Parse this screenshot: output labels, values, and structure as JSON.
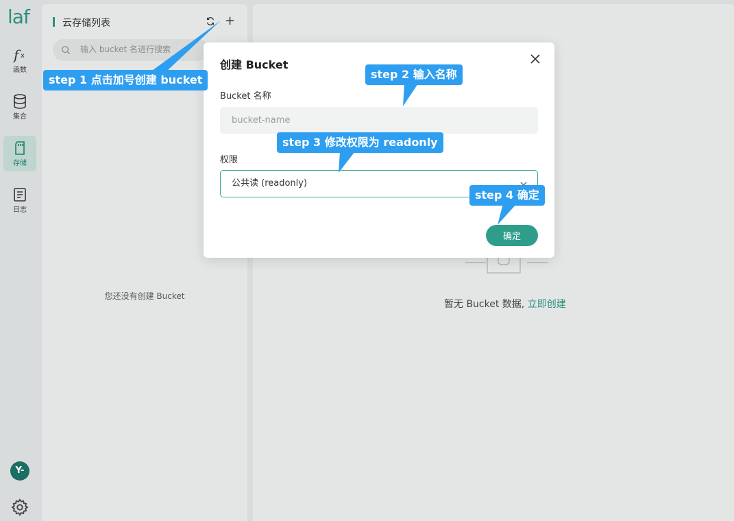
{
  "nav": {
    "logo": "laf",
    "items": [
      {
        "label": "函数",
        "icon": "function-icon"
      },
      {
        "label": "集合",
        "icon": "database-icon"
      },
      {
        "label": "存储",
        "icon": "storage-icon"
      },
      {
        "label": "日志",
        "icon": "log-icon"
      }
    ],
    "avatar": "Y-"
  },
  "panel": {
    "title": "云存储列表",
    "refresh_icon": "refresh-icon",
    "add_icon": "+",
    "search_placeholder": "输入 bucket 名进行搜索",
    "empty": "您还没有创建 Bucket"
  },
  "main": {
    "empty_text": "暂无 Bucket 数据,",
    "create_link": "立即创建"
  },
  "dialog": {
    "title": "创建 Bucket",
    "name_label": "Bucket 名称",
    "name_placeholder": "bucket-name",
    "perm_label": "权限",
    "perm_value": "公共读 (readonly)",
    "ok": "确定"
  },
  "callouts": {
    "step1": "step 1 点击加号创建 bucket",
    "step2": "step 2 输入名称",
    "step3": "step 3 修改权限为 readonly",
    "step4": "step 4 确定"
  },
  "colors": {
    "accent": "#2e9e8b",
    "callout": "#2e9ef0"
  }
}
